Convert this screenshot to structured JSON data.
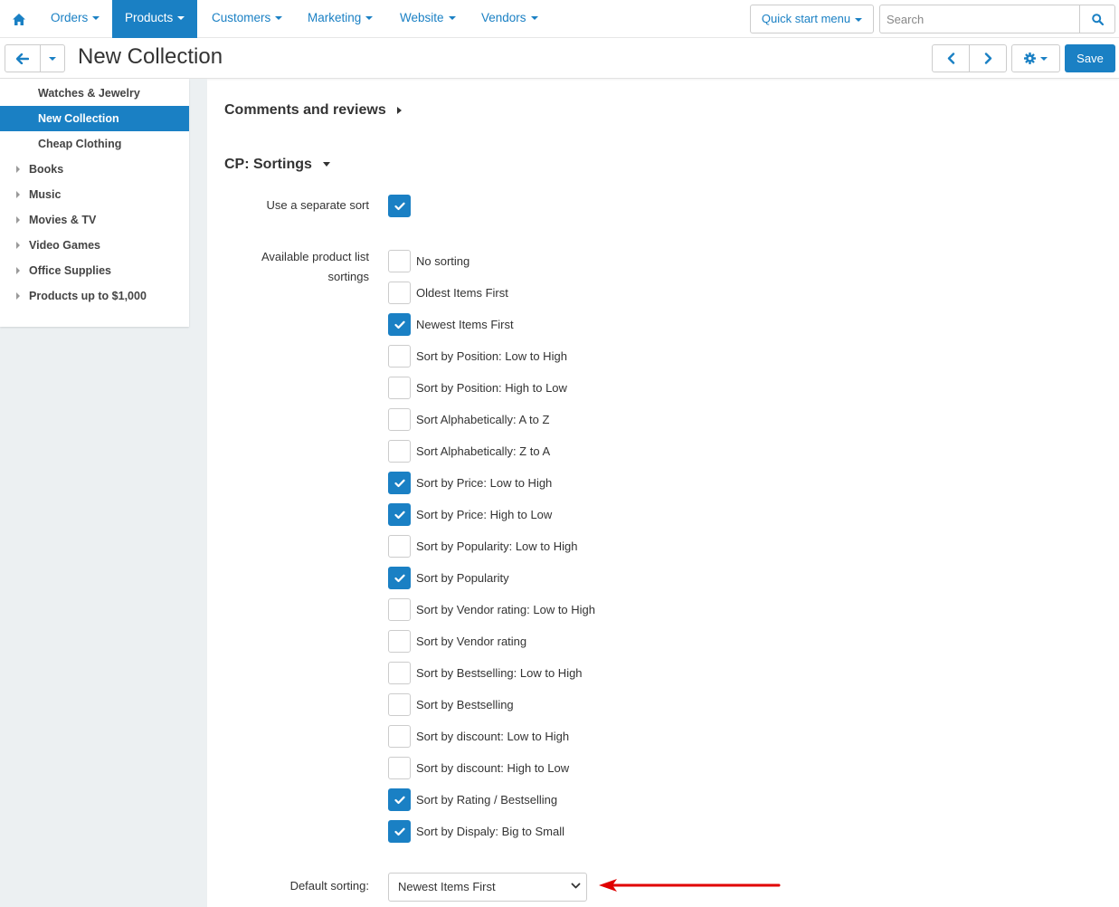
{
  "nav": {
    "items": [
      "Orders",
      "Products",
      "Customers",
      "Marketing",
      "Website",
      "Vendors"
    ],
    "active": "Products",
    "quick_start": "Quick start menu",
    "search_placeholder": "Search"
  },
  "toolbar": {
    "title": "New Collection",
    "save_label": "Save"
  },
  "sidebar": {
    "items": [
      {
        "label": "Watches & Jewelry",
        "indent": true,
        "active": false
      },
      {
        "label": "New Collection",
        "indent": true,
        "active": true
      },
      {
        "label": "Cheap Clothing",
        "indent": true,
        "active": false
      },
      {
        "label": "Books",
        "indent": false,
        "active": false
      },
      {
        "label": "Music",
        "indent": false,
        "active": false
      },
      {
        "label": "Movies & TV",
        "indent": false,
        "active": false
      },
      {
        "label": "Video Games",
        "indent": false,
        "active": false
      },
      {
        "label": "Office Supplies",
        "indent": false,
        "active": false
      },
      {
        "label": "Products up to $1,000",
        "indent": false,
        "active": false
      }
    ]
  },
  "main": {
    "comments_title": "Comments and reviews",
    "sortings_title": "CP: Sortings",
    "separate_sort_label": "Use a separate sort",
    "separate_sort_checked": true,
    "available_label_line1": "Available product list",
    "available_label_line2": "sortings",
    "sortings": [
      {
        "label": "No sorting",
        "checked": false
      },
      {
        "label": "Oldest Items First",
        "checked": false
      },
      {
        "label": "Newest Items First",
        "checked": true
      },
      {
        "label": "Sort by Position: Low to High",
        "checked": false
      },
      {
        "label": "Sort by Position: High to Low",
        "checked": false
      },
      {
        "label": "Sort Alphabetically: A to Z",
        "checked": false
      },
      {
        "label": "Sort Alphabetically: Z to A",
        "checked": false
      },
      {
        "label": "Sort by Price: Low to High",
        "checked": true
      },
      {
        "label": "Sort by Price: High to Low",
        "checked": true
      },
      {
        "label": "Sort by Popularity: Low to High",
        "checked": false
      },
      {
        "label": "Sort by Popularity",
        "checked": true
      },
      {
        "label": "Sort by Vendor rating: Low to High",
        "checked": false
      },
      {
        "label": "Sort by Vendor rating",
        "checked": false
      },
      {
        "label": "Sort by Bestselling: Low to High",
        "checked": false
      },
      {
        "label": "Sort by Bestselling",
        "checked": false
      },
      {
        "label": "Sort by discount: Low to High",
        "checked": false
      },
      {
        "label": "Sort by discount: High to Low",
        "checked": false
      },
      {
        "label": "Sort by Rating / Bestselling",
        "checked": true
      },
      {
        "label": "Sort by Dispaly: Big to Small",
        "checked": true
      }
    ],
    "default_sorting_label": "Default sorting:",
    "default_sorting_value": "Newest Items First"
  },
  "colors": {
    "accent": "#1a80c4",
    "arrow": "#e00000",
    "sidebar_bg": "#ecf0f2"
  }
}
